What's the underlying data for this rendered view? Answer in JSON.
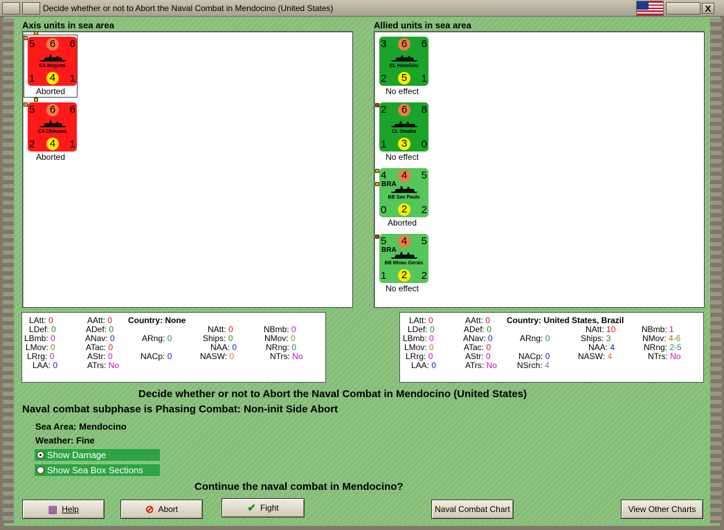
{
  "window": {
    "title": "Decide whether or not to Abort the Naval Combat in Mendocino (United States)",
    "close_glyph": "X"
  },
  "axis": {
    "header": "Axis units in sea area",
    "units": [
      {
        "name": "CA Mogami",
        "tl": "5",
        "tm": "6",
        "tr": "6",
        "bl": "1",
        "bm": "4",
        "br": "1",
        "status": "Aborted"
      },
      {
        "name": "CA Chikuma",
        "tl": "5",
        "tm": "6",
        "tr": "6",
        "bl": "2",
        "bm": "4",
        "br": "1",
        "status": "Aborted"
      }
    ],
    "stats": {
      "country": "Country: None",
      "LAtt": "0",
      "LDef": "0",
      "LBmb": "0",
      "LMov": "0",
      "LRrg": "0",
      "LAA": "0",
      "AAtt": "0",
      "ADef": "0",
      "ANav": "0",
      "ATac": "0",
      "AStr": "0",
      "ATrs": "No",
      "ARng": "0",
      "NACp": "0",
      "NAtt": "0",
      "Ships": "0",
      "NAA": "0",
      "NASW": "0",
      "NBmb": "0",
      "NMov": "0",
      "NRng": "0",
      "NTrs": "No"
    }
  },
  "allied": {
    "header": "Allied units in sea area",
    "units": [
      {
        "name": "CL Honolulu",
        "nat": "",
        "tl": "3",
        "tm": "6",
        "tr": "6",
        "bl": "2",
        "bm": "5",
        "br": "1",
        "status": "No effect"
      },
      {
        "name": "CL Omaha",
        "nat": "",
        "tl": "2",
        "tm": "6",
        "tr": "8",
        "bl": "1",
        "bm": "3",
        "br": "0",
        "status": "No effect"
      },
      {
        "name": "BB Sao Paulo",
        "nat": "BRA",
        "tl": "4",
        "tm": "4",
        "tr": "5",
        "bl": "0",
        "bm": "2",
        "br": "2",
        "status": "Aborted"
      },
      {
        "name": "BB Minas Gerais",
        "nat": "BRA",
        "tl": "5",
        "tm": "4",
        "tr": "5",
        "bl": "1",
        "bm": "2",
        "br": "2",
        "status": "No effect"
      }
    ],
    "stats": {
      "country": "Country: United States, Brazil",
      "LAtt": "0",
      "LDef": "0",
      "LBmb": "0",
      "LMov": "0",
      "LRrg": "0",
      "LAA": "0",
      "AAtt": "0",
      "ADef": "0",
      "ANav": "0",
      "ATac": "0",
      "AStr": "0",
      "ATrs": "No",
      "ARng": "0",
      "NACp": "0",
      "NSrch": "4",
      "NAtt": "10",
      "Ships": "3",
      "NAA": "4",
      "NASW": "4",
      "NBmb": "1",
      "NMov": "4-6",
      "NRng": "2-5",
      "NTrs": "No"
    }
  },
  "labels": {
    "LAtt": "LAtt:",
    "LDef": "LDef:",
    "LBmb": "LBmb:",
    "LMov": "LMov:",
    "LRrg": "LRrg:",
    "LAA": "LAA:",
    "AAtt": "AAtt:",
    "ADef": "ADef:",
    "ANav": "ANav:",
    "ATac": "ATac:",
    "AStr": "AStr:",
    "ATrs": "ATrs:",
    "ARng": "ARng:",
    "NACp": "NACp:",
    "NSrch": "NSrch:",
    "NAtt": "NAtt:",
    "Ships": "Ships:",
    "NAA": "NAA:",
    "NASW": "NASW:",
    "NBmb": "NBmb:",
    "NMov": "NMov:",
    "NRng": "NRng:",
    "NTrs": "NTrs:"
  },
  "main": {
    "decision_line": "Decide whether or not to Abort the Naval Combat in Mendocino (United States)",
    "subphase_line": "Naval combat subphase is Phasing Combat: Non-init Side Abort",
    "sea_area": "Sea Area:  Mendocino",
    "weather": "Weather:  Fine",
    "option_damage": "Show Damage",
    "option_sections": "Show Sea Box Sections",
    "question": "Continue the naval combat in Mendocino?"
  },
  "buttons": {
    "help": "Help",
    "abort": "Abort",
    "fight": "Fight",
    "naval_chart": "Naval Combat Chart",
    "other_charts": "View Other Charts"
  },
  "colors": {
    "axis_counter": "#ff1a1a",
    "allied_us_counter": "#1aa42a",
    "allied_bra_counter": "#55c65a",
    "background": "#88c27b"
  }
}
